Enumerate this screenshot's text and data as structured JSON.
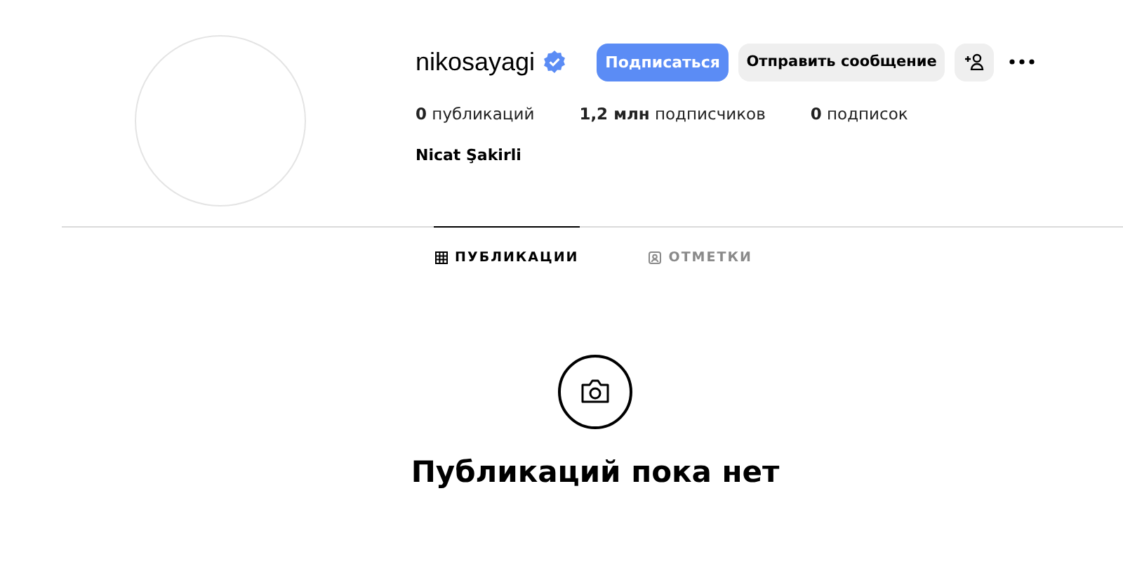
{
  "profile": {
    "username": "nikosayagi",
    "verified": true,
    "full_name": "Nicat Şakirli"
  },
  "buttons": [
    {
      "kind": "primary",
      "label": "Подписаться"
    },
    {
      "kind": "secondary",
      "label": "Отправить сообщение"
    },
    {
      "kind": "add-person"
    },
    {
      "kind": "more"
    }
  ],
  "stats": [
    "**0** публикаций",
    "**1,2 млн** подписчиков",
    "**0** подписок"
  ],
  "tabs": [
    {
      "label": "ПУБЛИКАЦИИ",
      "kind": "grid",
      "selected": true
    },
    {
      "label": "ОТМЕТКИ",
      "kind": "tag",
      "selected": false
    }
  ],
  "empty_state": {
    "title": "Публикаций пока нет"
  }
}
